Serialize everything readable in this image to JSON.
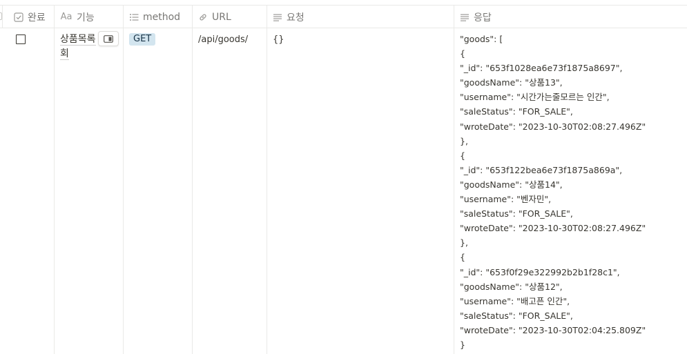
{
  "columns": {
    "done": "완료",
    "feature": "기능",
    "method": "method",
    "url": "URL",
    "request": "요청",
    "response": "응답"
  },
  "row": {
    "done": false,
    "feature": "상품목록 회",
    "method": "GET",
    "url": "/api/goods/",
    "request": "{}",
    "response_lines": [
      "\"goods\": [",
      "{",
      "\"_id\": \"653f1028ea6e73f1875a8697\",",
      "\"goodsName\": \"상품13\",",
      "\"username\": \"시간가는줄모르는 인간\",",
      "\"saleStatus\": \"FOR_SALE\",",
      "\"wroteDate\": \"2023-10-30T02:08:27.496Z\"",
      "},",
      "{",
      "\"_id\": \"653f122bea6e73f1875a869a\",",
      "\"goodsName\": \"상품14\",",
      "\"username\": \"벤자민\",",
      "\"saleStatus\": \"FOR_SALE\",",
      "\"wroteDate\": \"2023-10-30T02:08:27.496Z\"",
      "},",
      "{",
      "\"_id\": \"653f0f29e322992b2b1f28c1\",",
      "\"goodsName\": \"상품12\",",
      "\"username\": \"배고픈 인간\",",
      "\"saleStatus\": \"FOR_SALE\",",
      "\"wroteDate\": \"2023-10-30T02:04:25.809Z\"",
      "}"
    ]
  },
  "colors": {
    "tag_bg": "#d3e5ef",
    "tag_text": "#183347",
    "header_text": "#787774",
    "border": "#e9e9e7"
  }
}
